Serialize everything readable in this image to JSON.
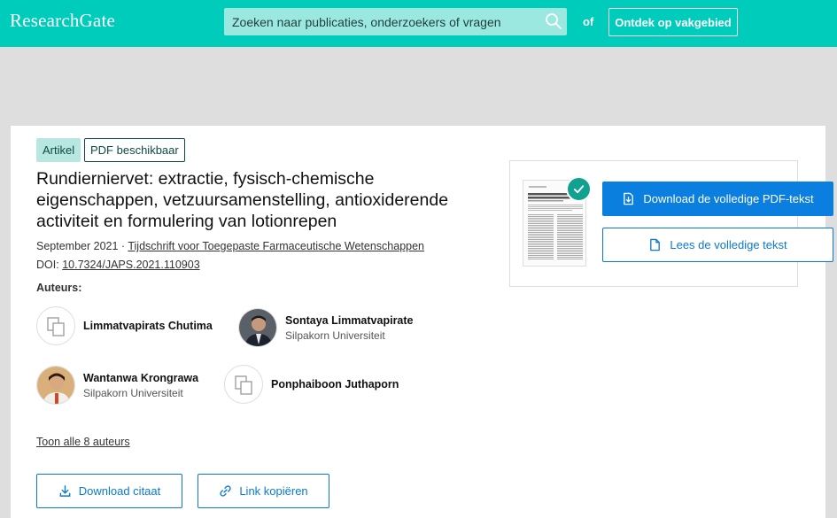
{
  "header": {
    "logo": "ResearchGate",
    "search_placeholder": "Zoeken naar publicaties, onderzoekers of vragen",
    "or_text": "of",
    "explore_label": "Ontdek op vakgebied"
  },
  "article": {
    "type_badge": "Artikel",
    "pdf_badge": "PDF beschikbaar",
    "title": "Rundierniervet: extractie, fysisch-chemische eigenschappen, vetzuursamenstelling, antioxiderende activiteit en formulering van lotionrepen",
    "date": "September 2021",
    "separator": "·",
    "journal": "Tijdschrift voor Toegepaste Farmaceutische Wetenschappen",
    "doi_label": "DOI:",
    "doi": "10.7324/JAPS.2021.110903",
    "authors_label": "Auteurs:",
    "show_all": "Toon alle 8 auteurs"
  },
  "authors": [
    {
      "name": "Limmatvapirats Chutima",
      "affiliation": ""
    },
    {
      "name": "Sontaya Limmatvapirate",
      "affiliation": "Silpakorn Universiteit"
    },
    {
      "name": "Wantanwa Krongrawa",
      "affiliation": "Silpakorn Universiteit"
    },
    {
      "name": "Ponphaiboon Juthaporn",
      "affiliation": ""
    }
  ],
  "actions": {
    "download_citation": "Download citaat",
    "copy_link": "Link kopiëren",
    "download_pdf": "Download de volledige PDF-tekst",
    "read_full": "Lees de volledige tekst"
  },
  "colors": {
    "brand": "#00ccbb",
    "primary": "#0a7fe0",
    "check": "#11a28f"
  }
}
